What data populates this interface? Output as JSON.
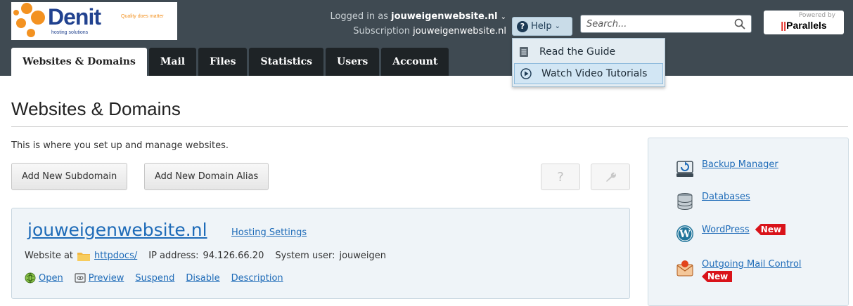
{
  "logo": {
    "word": "Denit",
    "tagline": "Quality does matter",
    "sub": "hosting solutions"
  },
  "header": {
    "logged_in_prefix": "Logged in as",
    "logged_in_user": "jouweigenwebsite.nl",
    "subscription_prefix": "Subscription",
    "subscription_name": "jouweigenwebsite.nl",
    "help_label": "Help",
    "search_placeholder": "Search...",
    "powered_by": "Powered by",
    "powered_brand": "Parallels"
  },
  "tabs": [
    {
      "label": "Websites & Domains",
      "active": true
    },
    {
      "label": "Mail",
      "active": false
    },
    {
      "label": "Files",
      "active": false
    },
    {
      "label": "Statistics",
      "active": false
    },
    {
      "label": "Users",
      "active": false
    },
    {
      "label": "Account",
      "active": false
    }
  ],
  "help_menu": {
    "items": [
      {
        "label": "Read the Guide",
        "icon": "document-icon"
      },
      {
        "label": "Watch Video Tutorials",
        "icon": "play-icon",
        "highlighted": true
      }
    ]
  },
  "main": {
    "title": "Websites & Domains",
    "intro": "This is where you set up and manage websites.",
    "buttons": {
      "add_subdomain": "Add New Subdomain",
      "add_alias": "Add New Domain Alias",
      "help_btn": "?",
      "settings_btn": "wrench-icon"
    }
  },
  "domain": {
    "name": "jouweigenwebsite.nl",
    "hosting_settings": "Hosting Settings",
    "website_at": "Website at",
    "docroot": "httpdocs/",
    "ip_label": "IP address:",
    "ip": "94.126.66.20",
    "user_label": "System user:",
    "user": "jouweigen",
    "actions": [
      "Open",
      "Preview",
      "Suspend",
      "Disable",
      "Description"
    ]
  },
  "right_panel": {
    "items": [
      {
        "label": "Backup Manager",
        "icon": "backup-icon",
        "new": false
      },
      {
        "label": "Databases",
        "icon": "database-icon",
        "new": false
      },
      {
        "label": "WordPress",
        "icon": "wordpress-icon",
        "new": true
      },
      {
        "label": "Outgoing Mail Control",
        "icon": "mail-control-icon",
        "new": true
      }
    ],
    "new_badge": "New"
  },
  "colors": {
    "header_bg": "#3f4a52",
    "tab_bg": "#1e2326",
    "link": "#1e6bb8",
    "badge": "#d9131a",
    "panel_bg": "#eff4f8"
  }
}
